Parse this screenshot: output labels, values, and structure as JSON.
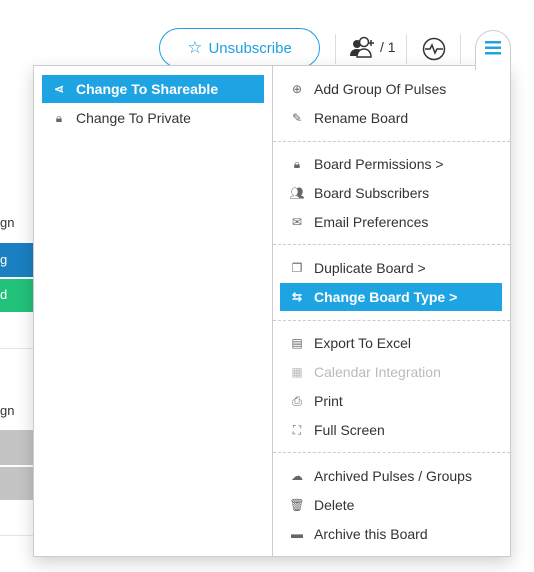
{
  "background": {
    "texts": [
      "gn",
      "g",
      "d",
      "gn"
    ],
    "colors": {
      "blue": "#1a80c2",
      "green": "#22c27a",
      "gray": "#c4c4c4"
    }
  },
  "header": {
    "unsubscribe_label": "Unsubscribe",
    "subscribers_count": "/ 1"
  },
  "menu": {
    "left": [
      {
        "label": "Change To Shareable",
        "icon": "share-icon",
        "highlighted": true
      },
      {
        "label": "Change To Private",
        "icon": "lock-icon"
      }
    ],
    "right": [
      {
        "label": "Add Group Of Pulses",
        "icon": "plus-circle-icon"
      },
      {
        "label": "Rename Board",
        "icon": "pencil-icon"
      },
      {
        "label": "Board Permissions >",
        "icon": "lock-icon"
      },
      {
        "label": "Board Subscribers",
        "icon": "users-icon"
      },
      {
        "label": "Email Preferences",
        "icon": "envelope-icon"
      },
      {
        "label": "Duplicate Board >",
        "icon": "copy-icon"
      },
      {
        "label": "Change Board Type >",
        "icon": "swap-icon",
        "highlighted": true
      },
      {
        "label": "Export To Excel",
        "icon": "file-icon"
      },
      {
        "label": "Calendar Integration",
        "icon": "calendar-icon",
        "disabled": true
      },
      {
        "label": "Print",
        "icon": "print-icon"
      },
      {
        "label": "Full Screen",
        "icon": "fullscreen-icon"
      },
      {
        "label": "Archived Pulses / Groups",
        "icon": "cloud-icon"
      },
      {
        "label": "Delete",
        "icon": "trash-icon"
      },
      {
        "label": "Archive this Board",
        "icon": "archive-icon"
      }
    ]
  },
  "accent": "#1ea3e3"
}
